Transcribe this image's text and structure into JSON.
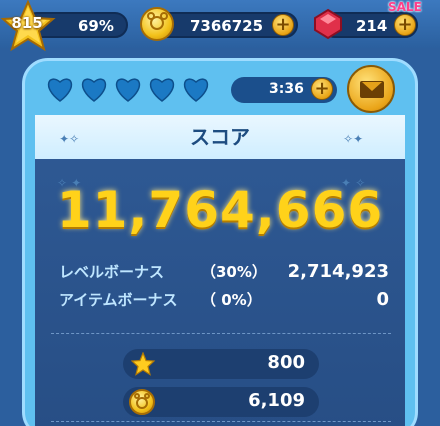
{
  "topbar": {
    "level": "815",
    "level_progress": "69%",
    "coins": "7366725",
    "gems": "214",
    "sale_label": "SALE"
  },
  "hearts": {
    "count_shown": 5,
    "timer": "3:36"
  },
  "score_panel": {
    "header": "スコア",
    "total_score": "11,764,666",
    "bonuses": [
      {
        "label": "レベルボーナス",
        "pct": "（30%）",
        "value": "2,714,923"
      },
      {
        "label": "アイテムボーナス",
        "pct": "（ 0%）",
        "value": "0"
      }
    ],
    "rewards": [
      {
        "icon": "star-icon",
        "value": "800"
      },
      {
        "icon": "coin-icon",
        "value": "6,109"
      }
    ]
  },
  "colors": {
    "background": "#2c5f9e",
    "panel_frame": "#5fc0f0",
    "score_gold": "#ffd21a",
    "heart_blue": "#1b79c4"
  }
}
